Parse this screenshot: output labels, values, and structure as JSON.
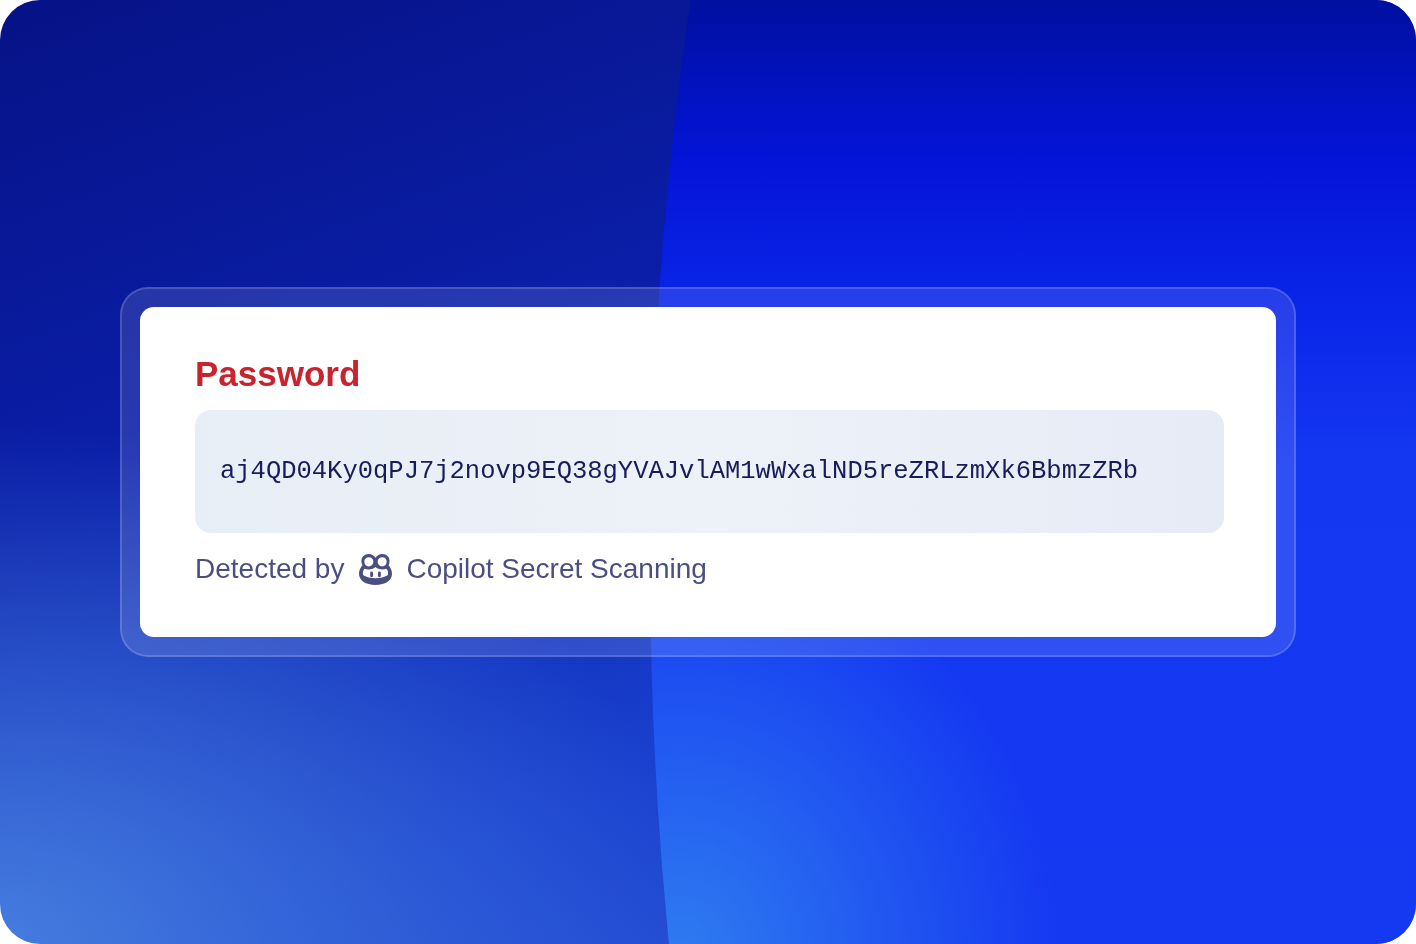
{
  "card": {
    "title": "Password",
    "secret": "aj4QD04Ky0qPJ7j2novp9EQ38gYVAJvlAM1wWxalND5reZRLzmXk6BbmzZRb",
    "detected_by": {
      "prefix": "Detected by",
      "source": "Copilot Secret Scanning"
    }
  }
}
